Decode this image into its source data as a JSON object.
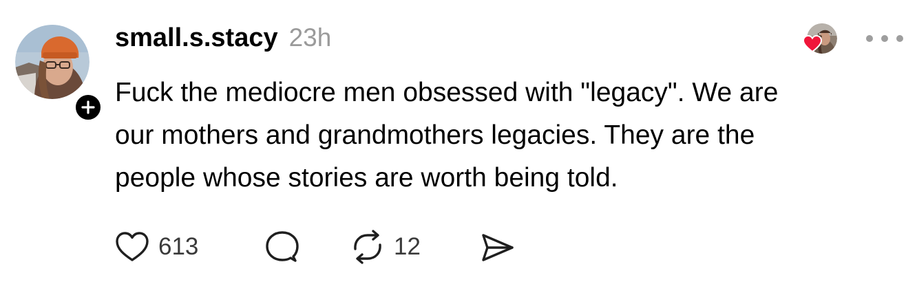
{
  "post": {
    "author": {
      "username": "small.s.stacy",
      "avatar_icon": "user-avatar-photo",
      "follow_icon": "plus-icon"
    },
    "timestamp": "23h",
    "liked_by_icon": "friend-liked-avatar",
    "more_icon": "more-horizontal-icon",
    "text": "Fuck the mediocre men obsessed with \"legacy\". We are\nour mothers and grandmothers legacies. They are the\npeople whose stories are worth being told.",
    "actions": {
      "like_count": "613",
      "reply_count": "",
      "repost_count": "12",
      "icons": [
        "heart-icon",
        "comment-icon",
        "repost-icon",
        "share-icon"
      ]
    }
  },
  "colors": {
    "text": "#000000",
    "muted": "#9a9a9a",
    "heart": "#f0163a",
    "icon": "#1f1f1f"
  }
}
